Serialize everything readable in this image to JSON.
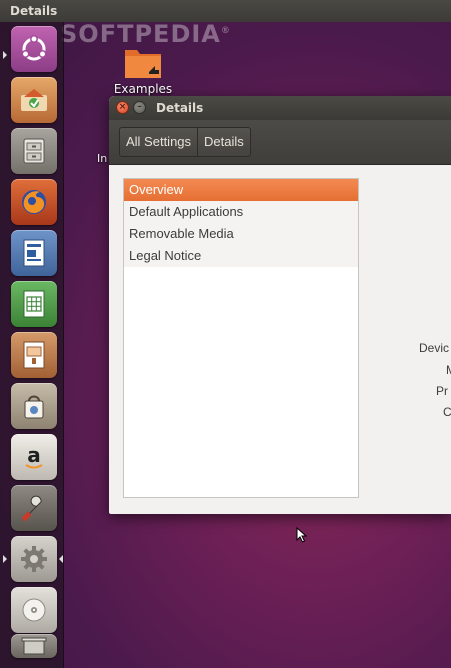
{
  "top_panel": {
    "title": "Details"
  },
  "watermark": "SOFTPEDIA",
  "launcher": {
    "items": [
      {
        "name": "dash-home",
        "icon": "ubuntu-logo-icon"
      },
      {
        "name": "software-updater",
        "icon": "software-updater-icon"
      },
      {
        "name": "files",
        "icon": "files-cabinet-icon"
      },
      {
        "name": "firefox",
        "icon": "firefox-icon"
      },
      {
        "name": "libreoffice-writer",
        "icon": "writer-icon"
      },
      {
        "name": "libreoffice-calc",
        "icon": "calc-icon"
      },
      {
        "name": "libreoffice-impress",
        "icon": "impress-icon"
      },
      {
        "name": "ubuntu-software",
        "icon": "shopping-bag-icon"
      },
      {
        "name": "amazon",
        "icon": "amazon-icon"
      },
      {
        "name": "system-tools",
        "icon": "wrench-icon"
      },
      {
        "name": "system-settings",
        "icon": "gear-icon"
      },
      {
        "name": "optical-disc",
        "icon": "disc-icon"
      },
      {
        "name": "trash",
        "icon": "trash-icon"
      }
    ]
  },
  "desktop": {
    "examples_label": "Examples",
    "partial_label": "In"
  },
  "window": {
    "title": "Details",
    "close_glyph": "×",
    "min_glyph": "–",
    "breadcrumbs": [
      "All Settings",
      "Details"
    ],
    "sections": [
      {
        "label": "Overview",
        "selected": true
      },
      {
        "label": "Default Applications",
        "selected": false
      },
      {
        "label": "Removable Media",
        "selected": false
      },
      {
        "label": "Legal Notice",
        "selected": false
      }
    ],
    "detail_labels": [
      "Devic",
      "M",
      "Pr",
      "C"
    ]
  },
  "colors": {
    "accent": "#e66f33",
    "panel": "#3c3b37",
    "window_bg": "#f2f1f0"
  }
}
